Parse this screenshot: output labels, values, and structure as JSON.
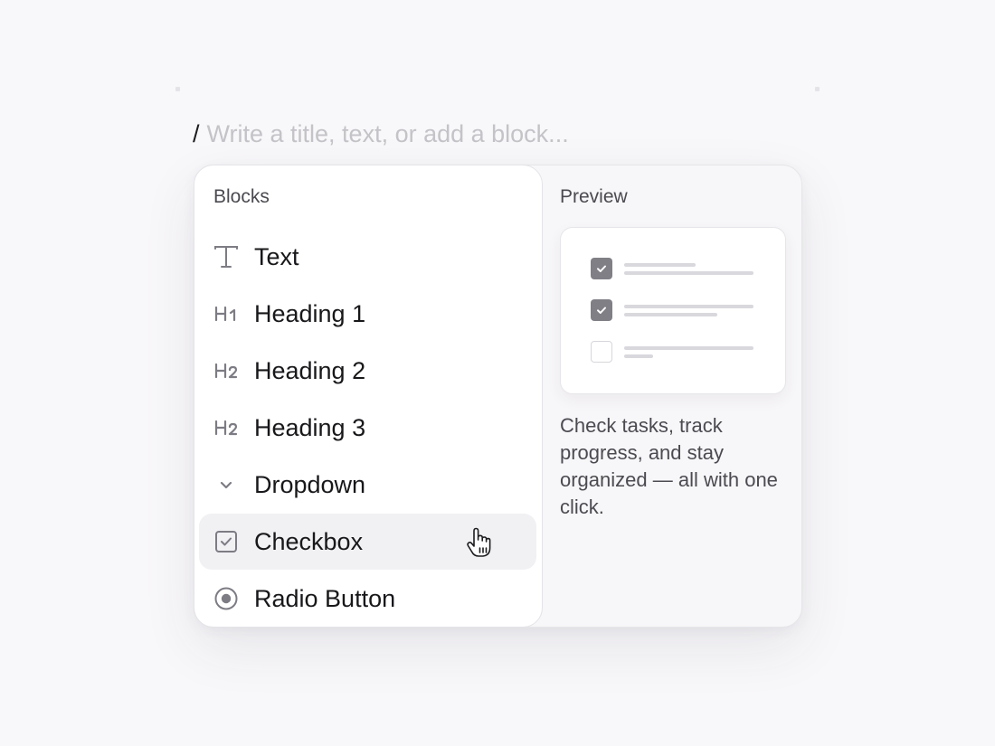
{
  "editor": {
    "slash": "/",
    "placeholder": "Write a title, text, or add a block..."
  },
  "blocks_panel": {
    "heading": "Blocks",
    "items": [
      {
        "label": "Text",
        "icon": "text-icon"
      },
      {
        "label": "Heading 1",
        "icon": "heading-1-icon"
      },
      {
        "label": "Heading 2",
        "icon": "heading-2-icon"
      },
      {
        "label": "Heading 3",
        "icon": "heading-3-icon"
      },
      {
        "label": "Dropdown",
        "icon": "chevron-down-icon"
      },
      {
        "label": "Checkbox",
        "icon": "checkbox-icon",
        "state": "hovered"
      },
      {
        "label": "Radio Button",
        "icon": "radio-button-icon"
      }
    ]
  },
  "preview_panel": {
    "heading": "Preview",
    "rows": [
      {
        "checked": true
      },
      {
        "checked": true
      },
      {
        "checked": false
      }
    ],
    "description": "Check tasks, track progress, and stay organized — all with one click."
  },
  "colors": {
    "background": "#f8f7f9",
    "panel": "#ffffff",
    "hover_background": "#f1f0f3",
    "icon": "#7d7c84",
    "checked_box": "#807f86",
    "placeholder": "#c4c3c8"
  }
}
